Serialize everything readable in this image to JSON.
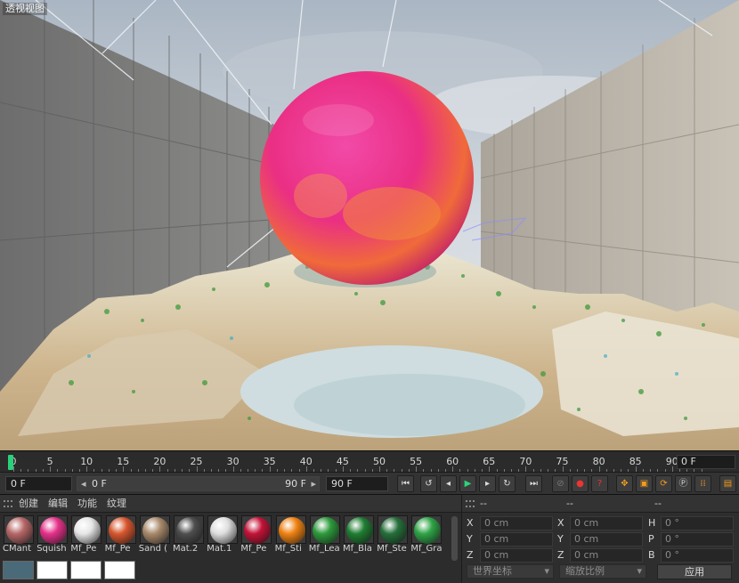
{
  "viewport": {
    "label": "透视视图"
  },
  "timeline": {
    "ticks": [
      "0",
      "5",
      "10",
      "15",
      "20",
      "25",
      "30",
      "35",
      "40",
      "45",
      "50",
      "55",
      "60",
      "65",
      "70",
      "75",
      "80",
      "85",
      "90"
    ],
    "current_frame": "0 F",
    "playhead_frame": 0
  },
  "transport": {
    "start_field": "0 F",
    "range_start": "0 F",
    "range_end": "90 F",
    "end_field": "90 F",
    "buttons": [
      "go-to-start",
      "prev-key",
      "prev-frame",
      "play",
      "next-frame",
      "next-key",
      "go-to-end",
      "record-off",
      "autokey",
      "keyframe-selection",
      "move-key",
      "scale-key",
      "rotation-key",
      "point-level",
      "param-key",
      "pla-key",
      "timeline"
    ]
  },
  "materials": {
    "menu": [
      "创建",
      "编辑",
      "功能",
      "纹理"
    ],
    "items": [
      {
        "name": "CMant",
        "color": "#b76767"
      },
      {
        "name": "Squish",
        "color": "#e5318a"
      },
      {
        "name": "Mf_Pe",
        "color": "#e6e6e6"
      },
      {
        "name": "Mf_Pe",
        "color": "#d7562e"
      },
      {
        "name": "Sand (",
        "color": "#a8896b"
      },
      {
        "name": "Mat.2",
        "color": "#4e4e4e"
      },
      {
        "name": "Mat.1",
        "color": "#dedede"
      },
      {
        "name": "Mf_Pe",
        "color": "#c31237"
      },
      {
        "name": "Mf_Sti",
        "color": "#ef8212"
      },
      {
        "name": "Mf_Lea",
        "color": "#2d9a3b"
      },
      {
        "name": "Mf_Bla",
        "color": "#1f7d32"
      },
      {
        "name": "Mf_Ste",
        "color": "#256f3a"
      },
      {
        "name": "Mf_Gra",
        "color": "#2fa447"
      }
    ]
  },
  "attributes": {
    "header": [
      "--",
      "--",
      "--"
    ],
    "rows": [
      {
        "l1": "X",
        "v1": "0 cm",
        "l2": "X",
        "v2": "0 cm",
        "l3": "H",
        "v3": "0 °"
      },
      {
        "l1": "Y",
        "v1": "0 cm",
        "l2": "Y",
        "v2": "0 cm",
        "l3": "P",
        "v3": "0 °"
      },
      {
        "l1": "Z",
        "v1": "0 cm",
        "l2": "Z",
        "v2": "0 cm",
        "l3": "B",
        "v3": "0 °"
      }
    ],
    "coord_dropdown": "世界坐标",
    "scale_dropdown": "缩放比例",
    "apply_label": "应用"
  }
}
